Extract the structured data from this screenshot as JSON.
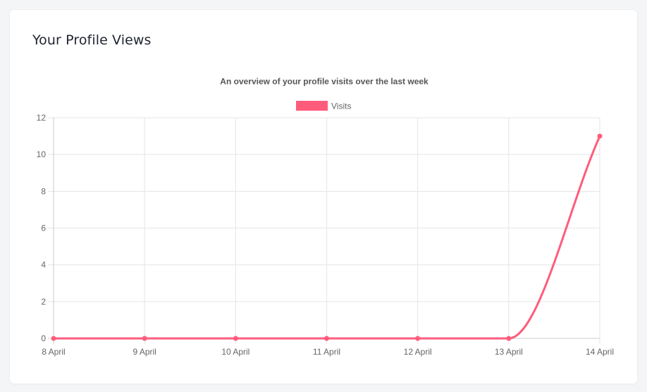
{
  "card": {
    "title": "Your Profile Views"
  },
  "colors": {
    "series": "#ff5c7c",
    "grid": "#e5e5e5",
    "axis": "#cccccc"
  },
  "chart_data": {
    "type": "line",
    "title": "An overview of your profile visits over the last week",
    "xlabel": "",
    "ylabel": "",
    "categories": [
      "8 April",
      "9 April",
      "10 April",
      "11 April",
      "12 April",
      "13 April",
      "14 April"
    ],
    "series": [
      {
        "name": "Visits",
        "values": [
          0,
          0,
          0,
          0,
          0,
          0,
          11
        ]
      }
    ],
    "ylim": [
      0,
      12
    ],
    "yticks": [
      0,
      2,
      4,
      6,
      8,
      10,
      12
    ],
    "grid": true,
    "legend": "top-center",
    "smooth": true
  }
}
